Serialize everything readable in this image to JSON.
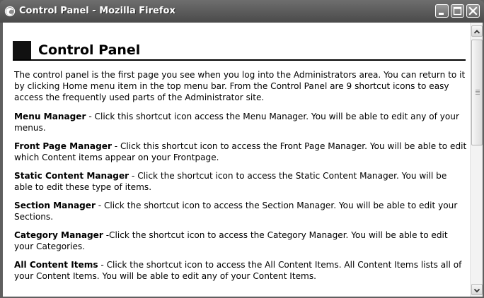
{
  "window": {
    "title": "Control Panel - Mozilla Firefox",
    "app_icon": "firefox-icon",
    "controls": [
      "minimize-icon",
      "maximize-icon",
      "close-icon"
    ]
  },
  "page": {
    "heading": "Control Panel",
    "intro": "The control panel is the first page you see when you log into the Administrators area. You can return to it by clicking Home menu item in the top menu bar.  From the Control Panel are 9 shortcut icons to easy access the frequently used parts of the Administrator site.",
    "items": [
      {
        "name": "Menu Manager",
        "desc": " - Click this shortcut icon access the Menu Manager.  You will be able  to  edit any of your menus."
      },
      {
        "name": "Front Page Manager",
        "desc": " -  Click this shortcut icon to access the Front Page Manager.  You will be able to edit which Content items appear on your Frontpage."
      },
      {
        "name": "Static Content Manager",
        "desc": " - Click  the shortcut icon to access the Static Content Manager.  You will be able to edit these type of  items."
      },
      {
        "name": "Section Manager",
        "desc": " - Click the shortcut icon to access the Section Manager.  You will be able to edit your Sections."
      },
      {
        "name": "Category Manager",
        "desc": " -Click the shortcut icon to access the Category Manager. You will be able to edit your Categories."
      },
      {
        "name": "All Content Items",
        "desc": " - Click the shortcut icon to access the All Content Items.  All Content Items  lists all of your Content Items.  You will be able to edit any of your Content Items."
      }
    ]
  },
  "colors": {
    "titlebar": "#5a5a5a",
    "heading_square": "#111111"
  }
}
